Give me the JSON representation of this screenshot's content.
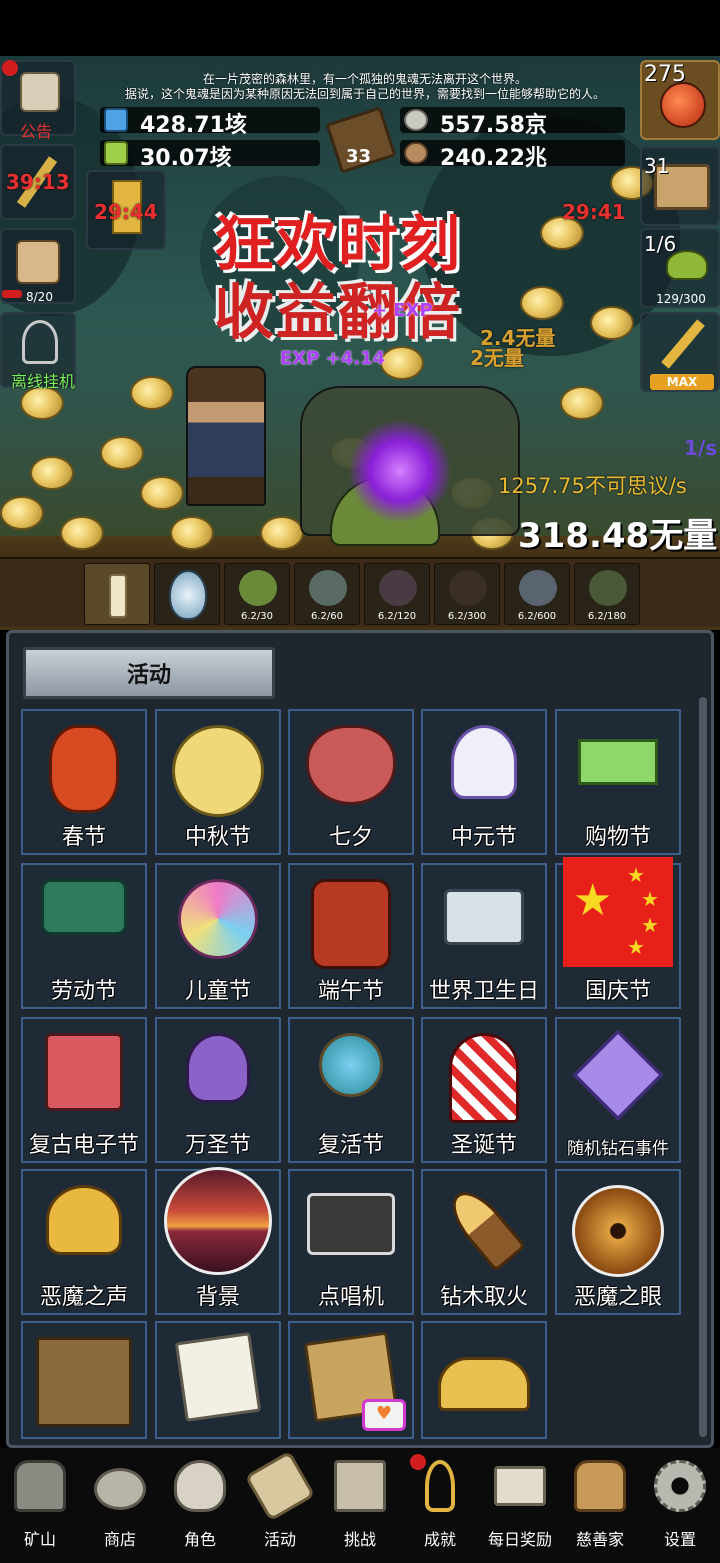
{
  "story": {
    "line1": "在一片茂密的森林里，有一个孤独的鬼魂无法离开这个世界。",
    "line2": "据说，这个鬼魂是因为某种原因无法回到属于自己的世界，需要找到一位能够帮助它的人。"
  },
  "resources": {
    "gem_blue": "428.71垓",
    "gem_green": "30.07垓",
    "book_count": "33",
    "coins": "557.58京",
    "meat": "240.22兆"
  },
  "left_side": {
    "notice_label": "公告",
    "timer1": "39:13",
    "timer2": "29:44",
    "mug_count": "8/20",
    "offline_label": "离线挂机"
  },
  "right_side": {
    "potion_count": "275",
    "chest_count": "31",
    "slime_count": "1/6",
    "slime_progress": "129/300",
    "timer3": "29:41",
    "sword_label": "MAX"
  },
  "event_banner": {
    "line1": "狂欢时刻",
    "line2": "收益翻倍"
  },
  "battle": {
    "exp1": "+ EXP",
    "exp2": "EXP +4.14",
    "dmg1": "2.4无量",
    "dmg2": "2无量",
    "rate_label": "1/s",
    "dps": "1257.75不可思议/s",
    "hp": "318.48无量"
  },
  "slots": [
    {
      "name": "candle",
      "label": ""
    },
    {
      "name": "egg",
      "label": ""
    },
    {
      "name": "slime",
      "label": "6.2/30"
    },
    {
      "name": "zombie",
      "label": "6.2/60"
    },
    {
      "name": "bat",
      "label": "6.2/120"
    },
    {
      "name": "spider",
      "label": "6.2/300"
    },
    {
      "name": "ghoul",
      "label": "6.2/600"
    },
    {
      "name": "orc",
      "label": "6.2/180"
    }
  ],
  "panel": {
    "tab_label": "活动",
    "events": [
      {
        "label": "春节",
        "icon": "lantern-icon"
      },
      {
        "label": "中秋节",
        "icon": "moon-icon"
      },
      {
        "label": "七夕",
        "icon": "heart-icon"
      },
      {
        "label": "中元节",
        "icon": "ghost-icon"
      },
      {
        "label": "购物节",
        "icon": "cash-icon"
      },
      {
        "label": "劳动节",
        "icon": "brush-icon"
      },
      {
        "label": "儿童节",
        "icon": "lollipop-icon"
      },
      {
        "label": "端午节",
        "icon": "dragon-mask-icon"
      },
      {
        "label": "世界卫生日",
        "icon": "ambulance-icon"
      },
      {
        "label": "国庆节",
        "icon": "flag-icon"
      },
      {
        "label": "复古电子节",
        "icon": "retro-computer-icon"
      },
      {
        "label": "万圣节",
        "icon": "monster-icon"
      },
      {
        "label": "复活节",
        "icon": "easter-egg-icon"
      },
      {
        "label": "圣诞节",
        "icon": "candy-cane-icon"
      },
      {
        "label": "随机钻石事件",
        "icon": "diamond-icon"
      },
      {
        "label": "恶魔之声",
        "icon": "bell-icon"
      },
      {
        "label": "背景",
        "icon": "sunset-icon"
      },
      {
        "label": "点唱机",
        "icon": "cassette-icon"
      },
      {
        "label": "钻木取火",
        "icon": "torch-icon"
      },
      {
        "label": "恶魔之眼",
        "icon": "eye-icon"
      },
      {
        "label": "",
        "icon": "crate-icon"
      },
      {
        "label": "",
        "icon": "letter-icon"
      },
      {
        "label": "",
        "icon": "map-icon"
      },
      {
        "label": "",
        "icon": "crown-icon"
      }
    ]
  },
  "nav": [
    {
      "label": "矿山",
      "icon": "lantern-icon"
    },
    {
      "label": "商店",
      "icon": "shell-icon"
    },
    {
      "label": "角色",
      "icon": "skull-icon"
    },
    {
      "label": "活动",
      "icon": "scroll-icon"
    },
    {
      "label": "挑战",
      "icon": "map-icon"
    },
    {
      "label": "成就",
      "icon": "key-icon"
    },
    {
      "label": "每日奖励",
      "icon": "envelope-icon"
    },
    {
      "label": "慈善家",
      "icon": "bread-icon"
    },
    {
      "label": "设置",
      "icon": "gear-icon"
    }
  ]
}
